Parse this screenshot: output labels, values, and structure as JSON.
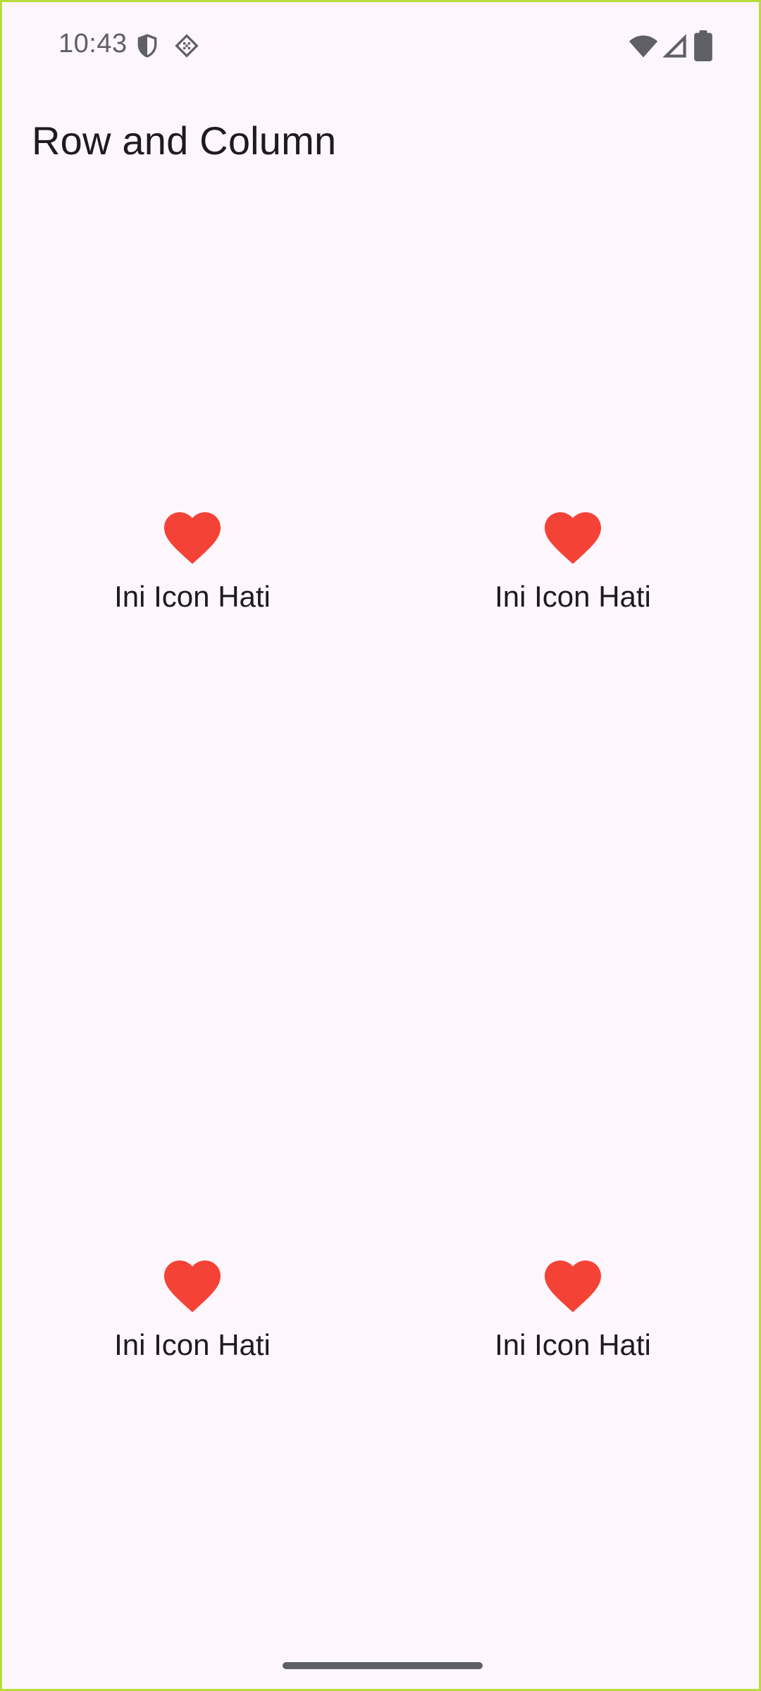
{
  "status_bar": {
    "time": "10:43",
    "icons": [
      "shield-icon",
      "diamond-grid-icon",
      "wifi-icon",
      "cell-signal-icon",
      "battery-icon"
    ]
  },
  "app_bar": {
    "title": "Row and Column"
  },
  "grid": {
    "items": [
      {
        "icon": "heart-icon",
        "label": "Ini Icon Hati"
      },
      {
        "icon": "heart-icon",
        "label": "Ini Icon Hati"
      },
      {
        "icon": "heart-icon",
        "label": "Ini Icon Hati"
      },
      {
        "icon": "heart-icon",
        "label": "Ini Icon Hati"
      }
    ]
  },
  "colors": {
    "background": "#fdf6fd",
    "heart": "#f44336",
    "text": "#1d1b20",
    "status": "#5f5f66"
  }
}
